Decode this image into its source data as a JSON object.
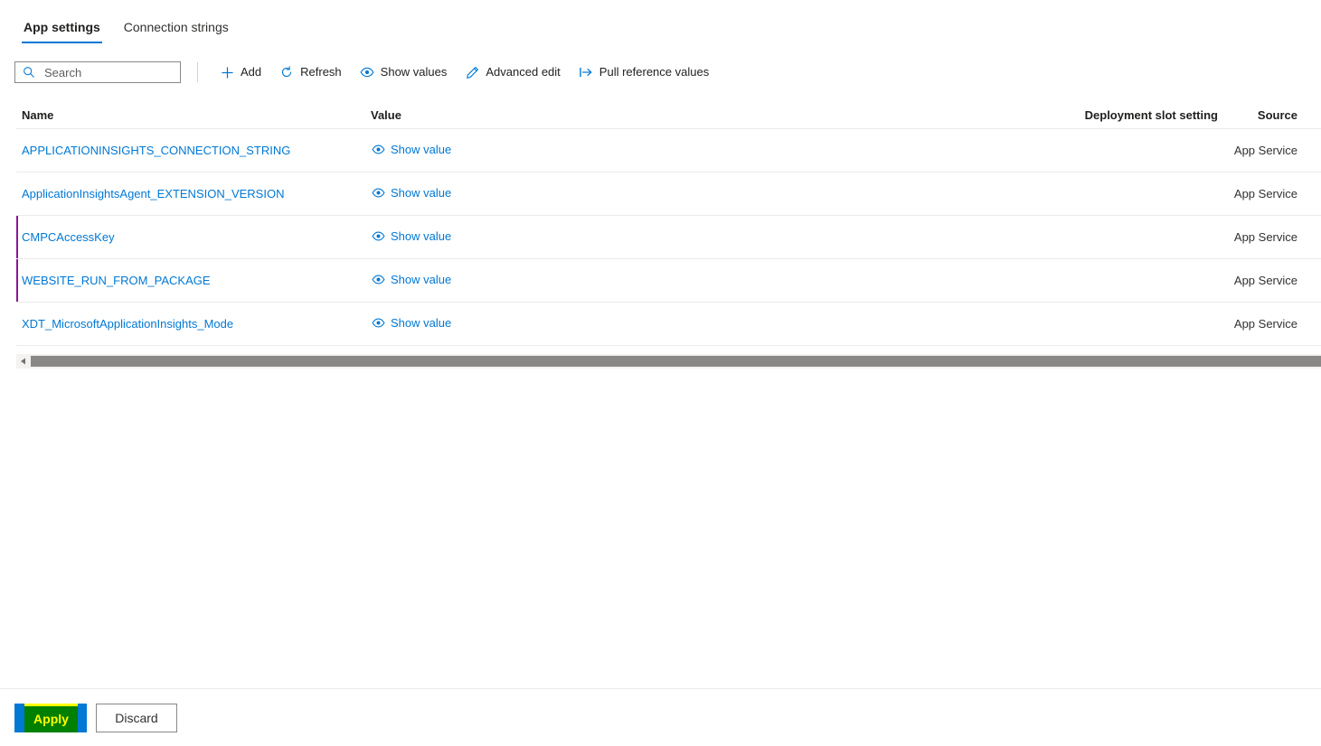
{
  "tabs": [
    {
      "label": "App settings",
      "active": true
    },
    {
      "label": "Connection strings",
      "active": false
    }
  ],
  "search": {
    "placeholder": "Search",
    "value": "",
    "icon": "search-icon"
  },
  "toolbar": {
    "items": [
      {
        "label": "Add",
        "icon": "plus-icon"
      },
      {
        "label": "Refresh",
        "icon": "refresh-icon"
      },
      {
        "label": "Show values",
        "icon": "eye-icon"
      },
      {
        "label": "Advanced edit",
        "icon": "pencil-icon"
      },
      {
        "label": "Pull reference values",
        "icon": "pull-arrow-icon"
      }
    ]
  },
  "table": {
    "columns": [
      "Name",
      "Value",
      "Deployment slot setting",
      "Source"
    ],
    "value_link_label": "Show value",
    "rows": [
      {
        "name": "APPLICATIONINSIGHTS_CONNECTION_STRING",
        "value": "Show value",
        "slot": "",
        "source": "App Service",
        "marked": false
      },
      {
        "name": "ApplicationInsightsAgent_EXTENSION_VERSION",
        "value": "Show value",
        "slot": "",
        "source": "App Service",
        "marked": false
      },
      {
        "name": "CMPCAccessKey",
        "value": "Show value",
        "slot": "",
        "source": "App Service",
        "marked": true
      },
      {
        "name": "WEBSITE_RUN_FROM_PACKAGE",
        "value": "Show value",
        "slot": "",
        "source": "App Service",
        "marked": true
      },
      {
        "name": "XDT_MicrosoftApplicationInsights_Mode",
        "value": "Show value",
        "slot": "",
        "source": "App Service",
        "marked": false
      }
    ]
  },
  "scrollbar": {
    "left_arrow_icon": "chevron-left-icon"
  },
  "footer": {
    "apply_label": "Apply",
    "discard_label": "Discard"
  },
  "colors": {
    "accent": "#0078d4",
    "link": "#0078d4",
    "marker": "#881798",
    "highlight_fill": "#008000",
    "highlight_edge": "#ffff00",
    "border": "#edebe9"
  }
}
